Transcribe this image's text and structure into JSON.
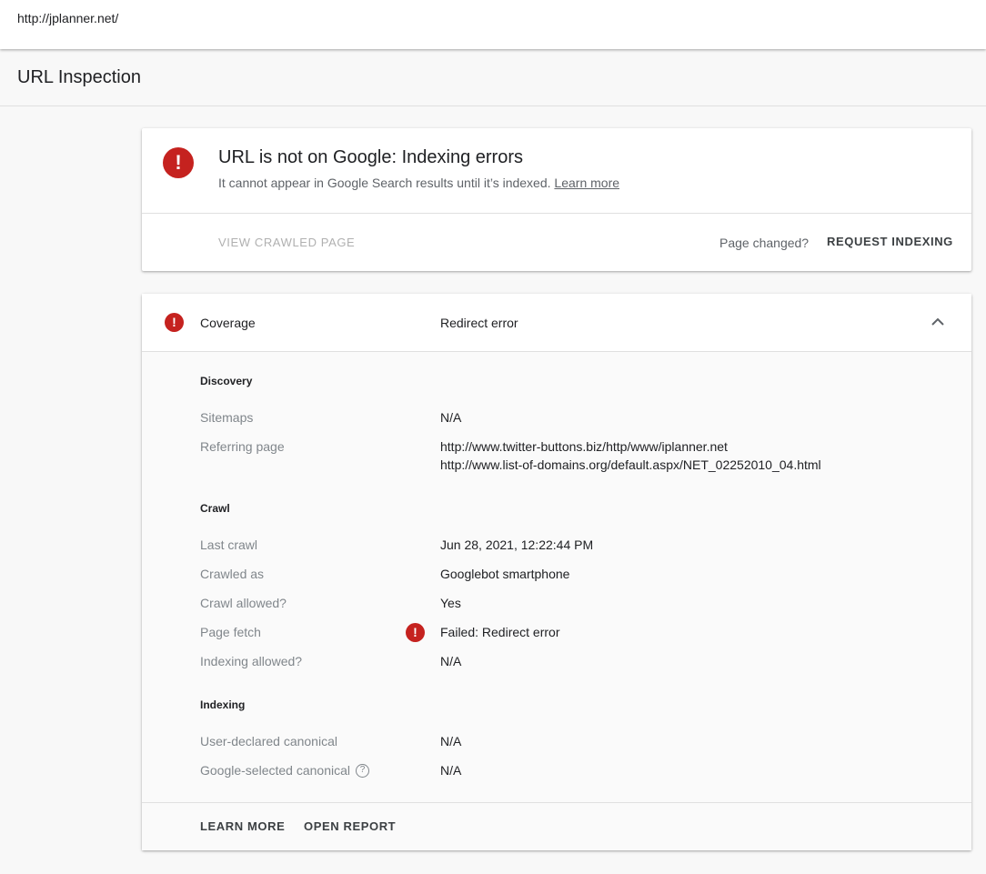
{
  "url_bar": {
    "url": "http://jplanner.net/"
  },
  "header": {
    "title": "URL Inspection"
  },
  "status": {
    "headline": "URL is not on Google: Indexing errors",
    "subtext": "It cannot appear in Google Search results until it’s indexed.",
    "learn_more_link": "Learn more",
    "view_crawled_page": "VIEW CRAWLED PAGE",
    "page_changed": "Page changed?",
    "request_indexing": "REQUEST INDEXING"
  },
  "coverage": {
    "label": "Coverage",
    "value": "Redirect error",
    "discovery": {
      "title": "Discovery",
      "sitemaps_label": "Sitemaps",
      "sitemaps_value": "N/A",
      "referring_label": "Referring page",
      "referring_values": [
        "http://www.twitter-buttons.biz/http/www/iplanner.net",
        "http://www.list-of-domains.org/default.aspx/NET_02252010_04.html"
      ]
    },
    "crawl": {
      "title": "Crawl",
      "rows": [
        {
          "label": "Last crawl",
          "value": "Jun 28, 2021, 12:22:44 PM"
        },
        {
          "label": "Crawled as",
          "value": "Googlebot smartphone"
        },
        {
          "label": "Crawl allowed?",
          "value": "Yes"
        },
        {
          "label": "Page fetch",
          "value": "Failed: Redirect error"
        },
        {
          "label": "Indexing allowed?",
          "value": "N/A"
        }
      ]
    },
    "indexing": {
      "title": "Indexing",
      "rows": [
        {
          "label": "User-declared canonical",
          "value": "N/A"
        },
        {
          "label": "Google-selected canonical",
          "value": "N/A"
        }
      ]
    },
    "footer": {
      "learn_more": "LEARN MORE",
      "open_report": "OPEN REPORT"
    }
  },
  "icons": {
    "error": "error-icon",
    "chevron": "chevron-up-icon",
    "help": "help-circle-icon"
  },
  "colors": {
    "error": "#c5221f"
  }
}
